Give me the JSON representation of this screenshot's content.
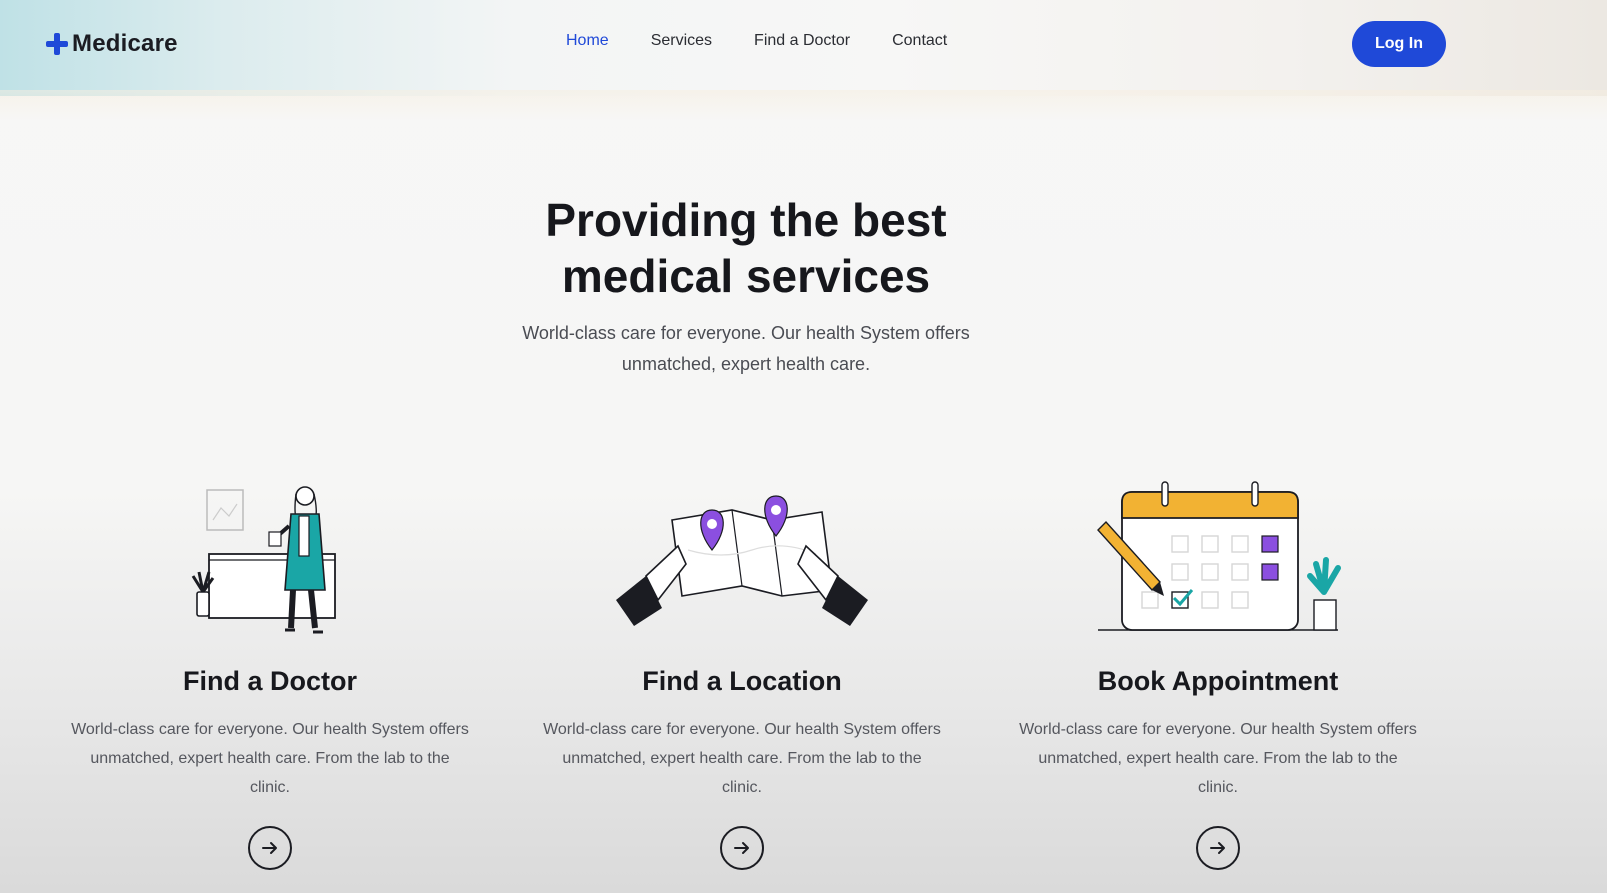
{
  "brand": {
    "name": "Medicare",
    "accent": "#1f49d8"
  },
  "nav": {
    "items": [
      {
        "label": "Home",
        "active": true
      },
      {
        "label": "Services",
        "active": false
      },
      {
        "label": "Find a Doctor",
        "active": false
      },
      {
        "label": "Contact",
        "active": false
      }
    ],
    "login_label": "Log In"
  },
  "hero": {
    "title_line1": "Providing the best",
    "title_line2": "medical services",
    "subtitle_line1": "World-class care for everyone. Our health System offers",
    "subtitle_line2": "unmatched, expert health care."
  },
  "cards": [
    {
      "title": "Find a Doctor",
      "text": "World-class care for everyone. Our health System offers unmatched, expert health care. From the lab to the clinic.",
      "icon": "doctor-illustration",
      "action_icon": "arrow-right-icon"
    },
    {
      "title": "Find a Location",
      "text": "World-class care for everyone. Our health System offers unmatched, expert health care. From the lab to the clinic.",
      "icon": "map-location-illustration",
      "action_icon": "arrow-right-icon"
    },
    {
      "title": "Book Appointment",
      "text": "World-class care for everyone. Our health System offers unmatched, expert health care. From the lab to the clinic.",
      "icon": "calendar-appointment-illustration",
      "action_icon": "arrow-right-icon"
    }
  ],
  "colors": {
    "teal": "#1aa6a6",
    "purple": "#8b4fe0",
    "orange": "#f2b233"
  }
}
